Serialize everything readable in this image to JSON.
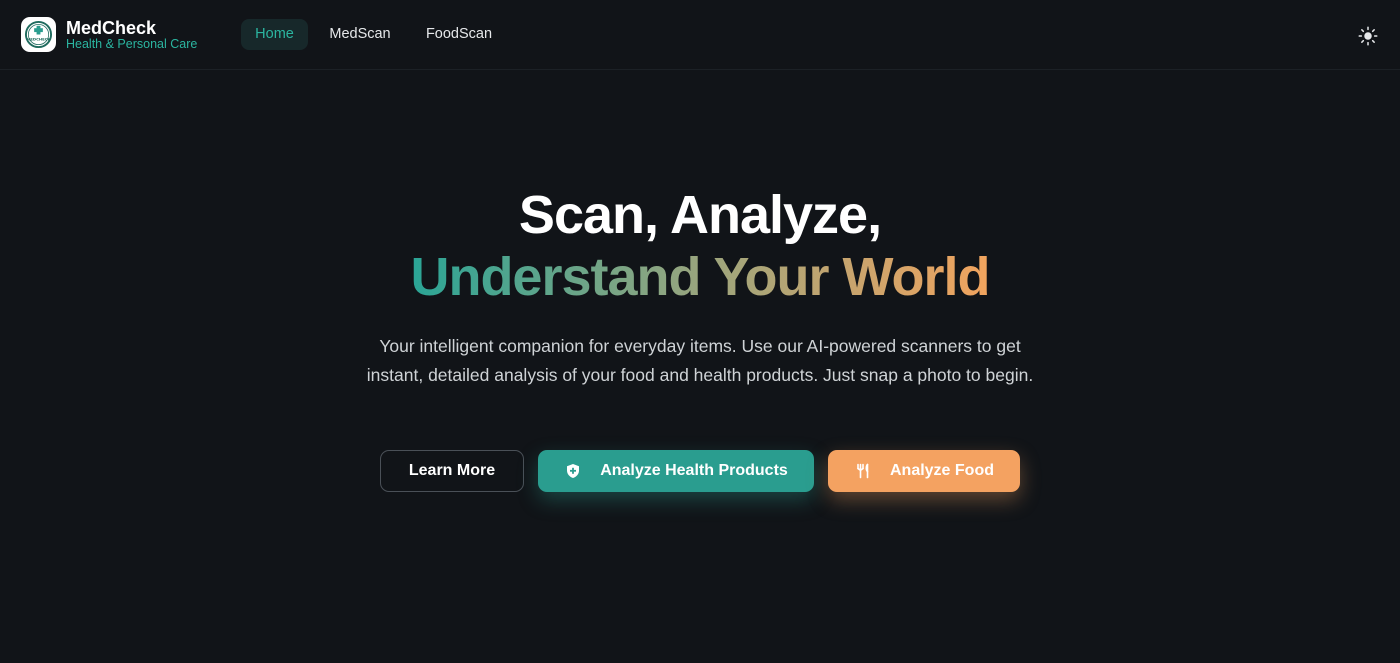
{
  "brand": {
    "name": "MedCheck",
    "tagline": "Health & Personal Care",
    "logo_text": "MEDCHECK"
  },
  "nav": {
    "items": [
      {
        "label": "Home",
        "active": true
      },
      {
        "label": "MedScan",
        "active": false
      },
      {
        "label": "FoodScan",
        "active": false
      }
    ]
  },
  "theme_toggle": {
    "icon": "sun-icon"
  },
  "hero": {
    "title_line1": "Scan, Analyze,",
    "title_line2": "Understand Your World",
    "description": "Your intelligent companion for everyday items. Use our AI-powered scanners to get instant, detailed analysis of your food and health products. Just snap a photo to begin."
  },
  "buttons": {
    "learn_more": "Learn More",
    "analyze_health": "Analyze Health Products",
    "analyze_health_icon": "shield-plus-icon",
    "analyze_food": "Analyze Food",
    "analyze_food_icon": "fork-knife-icon"
  },
  "colors": {
    "background": "#111418",
    "accent_teal": "#2a9d8f",
    "accent_orange": "#f4a261",
    "nav_active_text": "#2bb5a0"
  }
}
